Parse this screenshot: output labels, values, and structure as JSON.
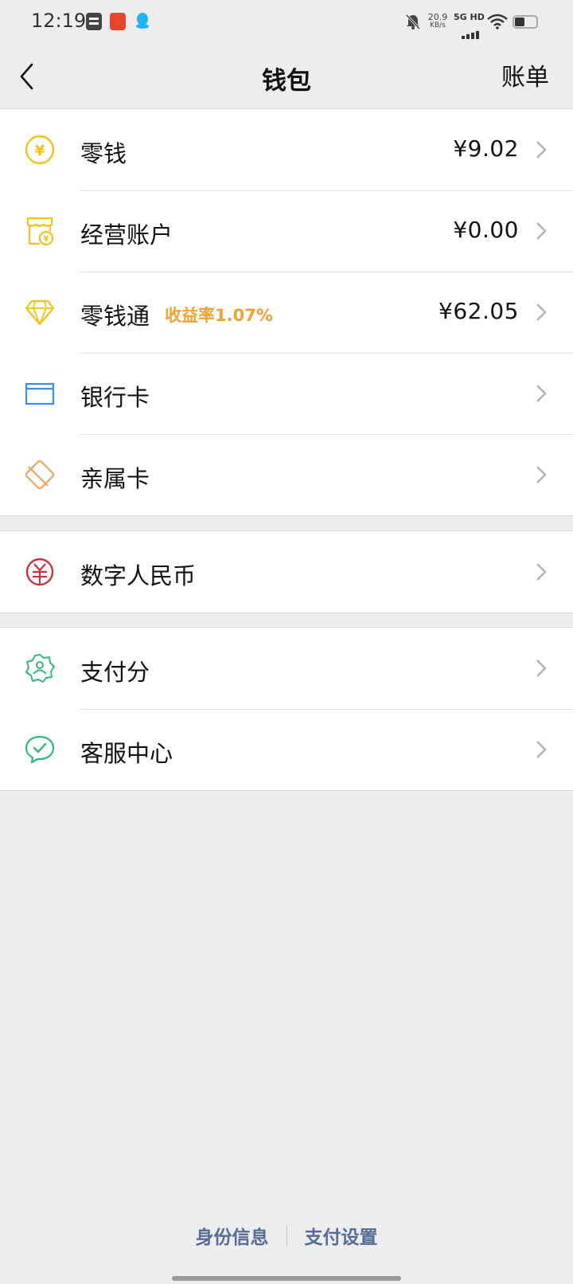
{
  "status_bar": {
    "time": "12:19",
    "app_icons": [
      "notes-app-icon",
      "bank-app-icon",
      "qq-app-icon"
    ],
    "net_speed_value": "20.9",
    "net_speed_unit": "KB/s",
    "network": "5G HD"
  },
  "nav": {
    "title": "钱包",
    "right_label": "账单"
  },
  "wallet_items": [
    {
      "label": "零钱",
      "value": "¥9.02",
      "icon": "yen-coin-icon",
      "color": "#f4c219"
    },
    {
      "label": "经营账户",
      "value": "¥0.00",
      "icon": "shop-account-icon",
      "color": "#f4c219"
    },
    {
      "label": "零钱通",
      "tag": "收益率1.07%",
      "value": "¥62.05",
      "icon": "diamond-icon",
      "color": "#f4c219"
    },
    {
      "label": "银行卡",
      "icon": "bank-card-icon",
      "color": "#3d8ee0"
    },
    {
      "label": "亲属卡",
      "icon": "family-card-icon",
      "color": "#f0a45c"
    }
  ],
  "ecny_item": {
    "label": "数字人民币",
    "icon": "ecny-icon",
    "color": "#c8333f"
  },
  "service_items": [
    {
      "label": "支付分",
      "icon": "pay-score-icon",
      "color": "#2fba7c"
    },
    {
      "label": "客服中心",
      "icon": "customer-service-icon",
      "color": "#2fba7c"
    }
  ],
  "footer": {
    "identity": "身份信息",
    "pay_settings": "支付设置"
  },
  "colors": {
    "background": "#ededed",
    "link": "#576b95",
    "tag": "#f0a233"
  }
}
